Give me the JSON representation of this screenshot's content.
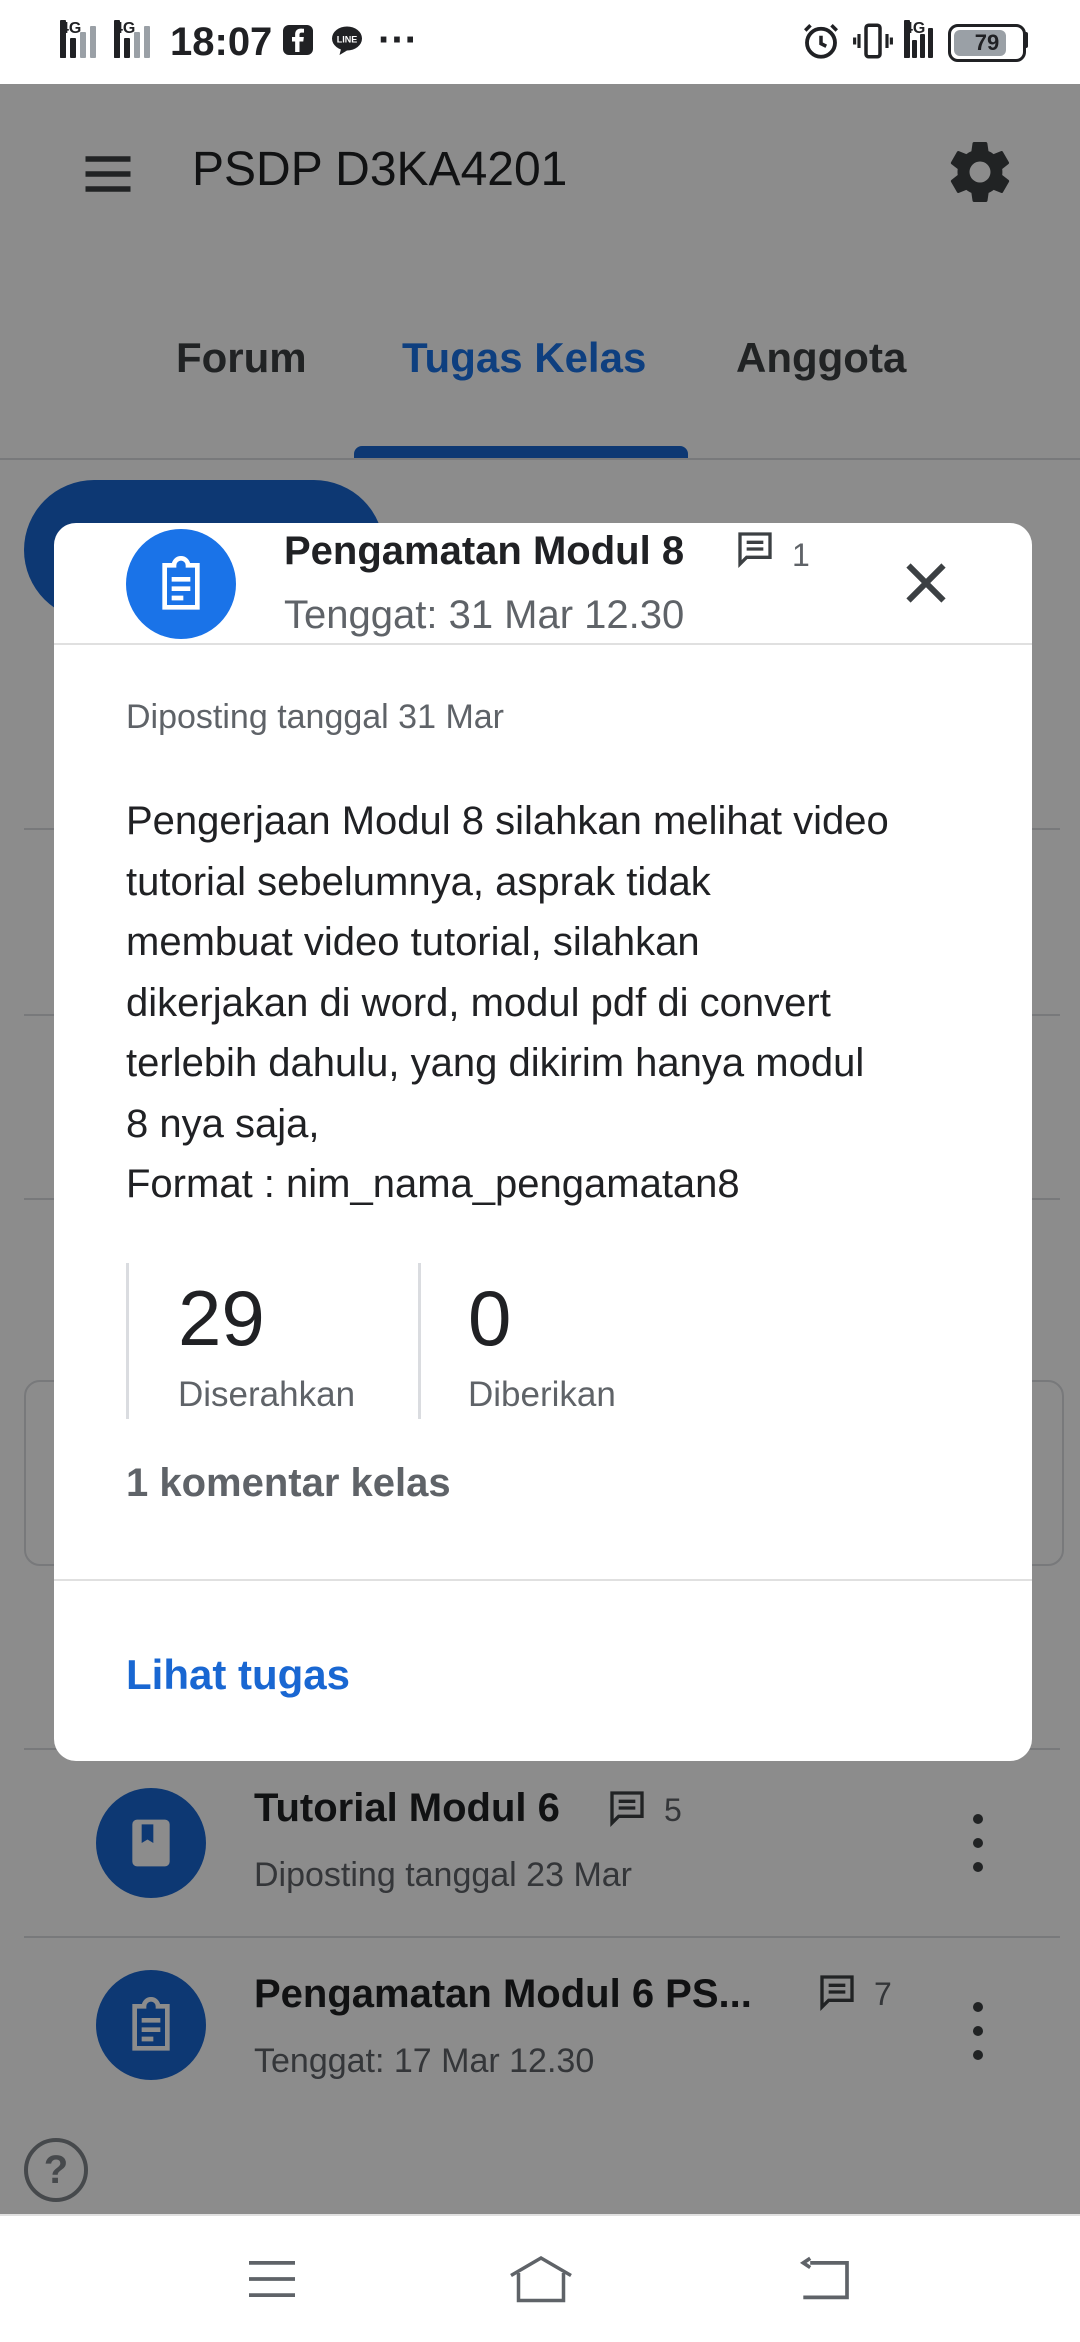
{
  "status_bar": {
    "time": "18:07",
    "network_left_1": "4G",
    "network_left_2": "4G",
    "network_right": "4G",
    "battery": "79",
    "more": "···"
  },
  "app_bar": {
    "title": "PSDP D3KA4201",
    "tabs": [
      {
        "label": "Forum",
        "active": false
      },
      {
        "label": "Tugas Kelas",
        "active": true
      },
      {
        "label": "Anggota",
        "active": false
      }
    ]
  },
  "background_list": [
    {
      "title": "Tutorial Modul 6",
      "comments": "5",
      "subtitle": "Diposting tanggal 23 Mar",
      "icon": "book-icon"
    },
    {
      "title": "Pengamatan Modul 6 PS...",
      "comments": "7",
      "subtitle": "Tenggat: 17 Mar 12.30",
      "icon": "assignment-icon"
    }
  ],
  "dialog": {
    "title": "Pengamatan Modul 8",
    "comment_count": "1",
    "due": "Tenggat: 31 Mar 12.30",
    "posted": "Diposting tanggal 31 Mar",
    "description": "Pengerjaan Modul 8 silahkan melihat video\ntutorial sebelumnya, asprak tidak\nmembuat video tutorial, silahkan\ndikerjakan di word, modul pdf di convert\nterlebih dahulu, yang dikirim hanya modul\n8 nya saja,\nFormat : nim_nama_pengamatan8",
    "stats": [
      {
        "value": "29",
        "label": "Diserahkan"
      },
      {
        "value": "0",
        "label": "Diberikan"
      }
    ],
    "class_comments": "1 komentar kelas",
    "action": "Lihat tugas"
  },
  "help": "?",
  "colors": {
    "accent": "#1a73e8",
    "accent_dark": "#1967d2",
    "text_secondary": "#5f6368",
    "scrim": "rgba(0,0,0,0.45)"
  }
}
